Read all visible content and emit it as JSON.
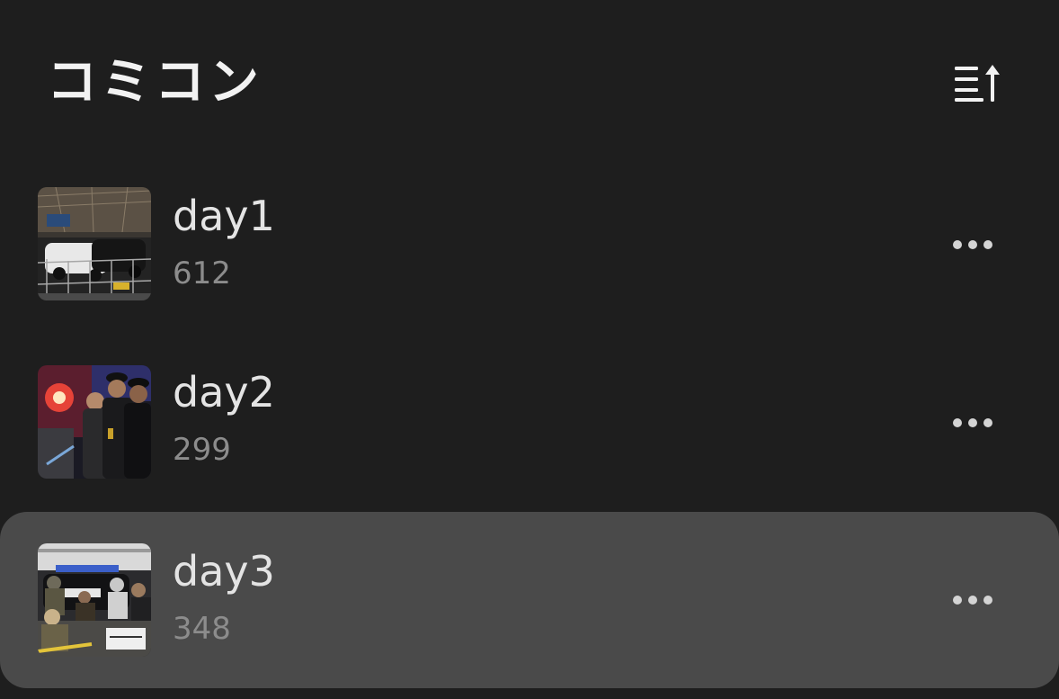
{
  "header": {
    "title": "コミコン",
    "sort_icon": "sort-ascending-icon"
  },
  "albums": [
    {
      "name": "day1",
      "count": "612",
      "thumbnail": "police-car-convention-photo",
      "selected": false
    },
    {
      "name": "day2",
      "count": "299",
      "thumbnail": "police-officers-photo",
      "selected": false
    },
    {
      "name": "day3",
      "count": "348",
      "thumbnail": "police-scene-photo",
      "selected": true
    }
  ],
  "colors": {
    "background": "#1e1e1e",
    "selected_row": "#4a4a4a",
    "primary_text": "#e4e4e4",
    "secondary_text": "#8c8c8c"
  }
}
